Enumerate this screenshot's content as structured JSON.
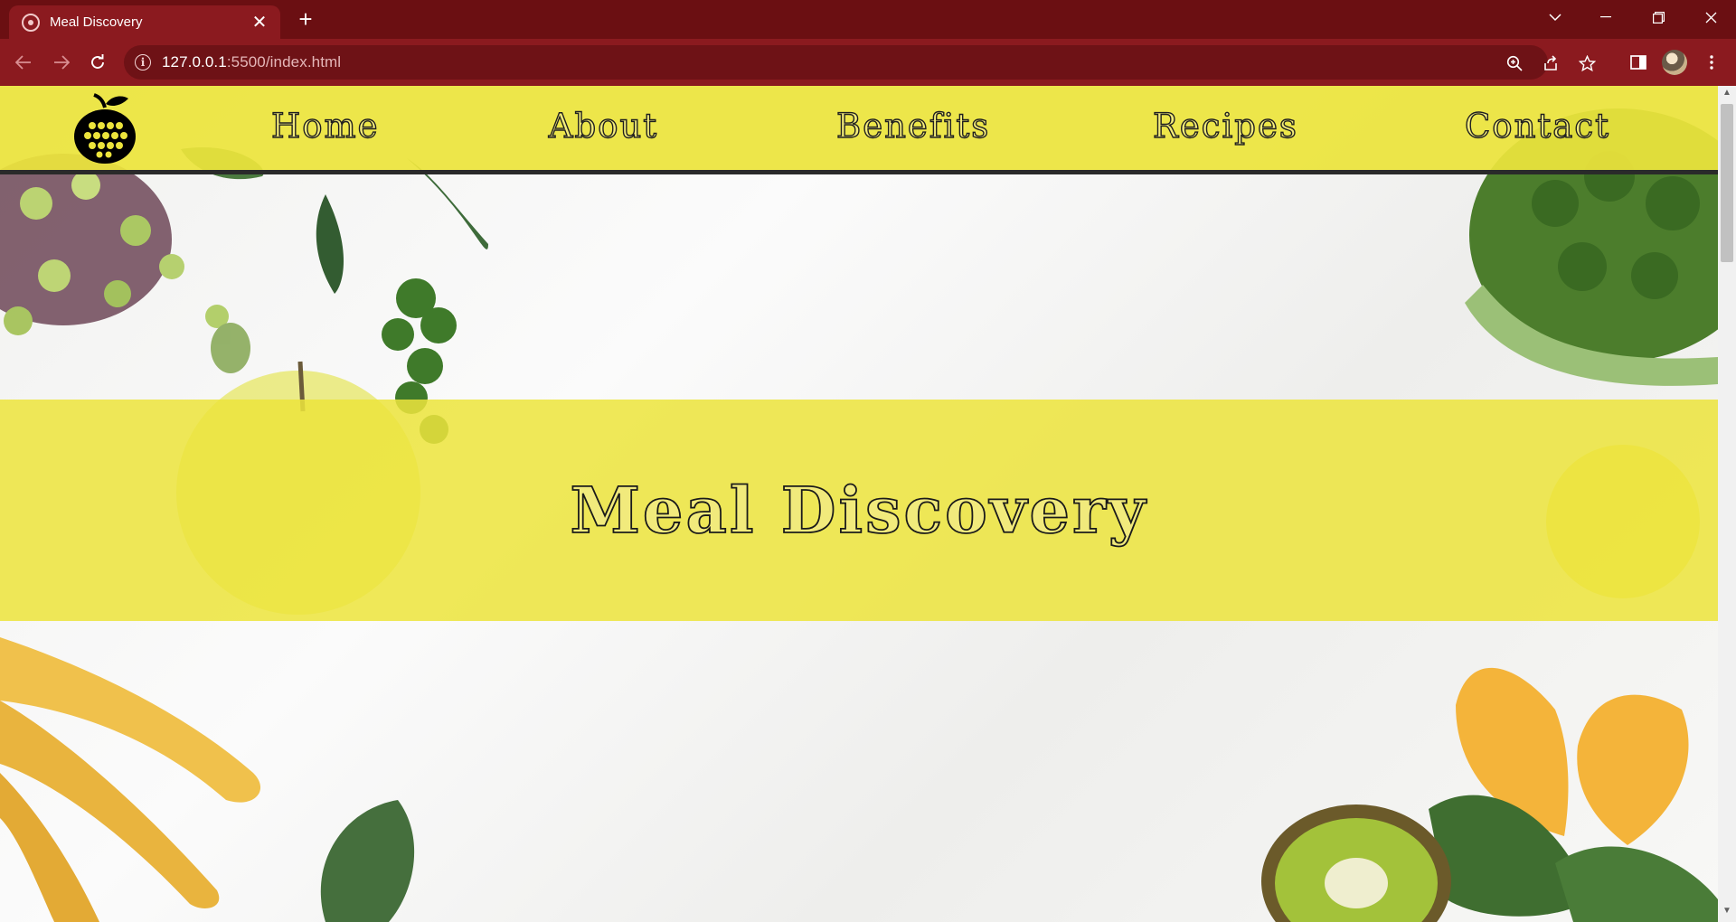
{
  "browser": {
    "tab_title": "Meal Discovery",
    "tab_close": "✕",
    "new_tab": "+",
    "url_host": "127.0.0.1",
    "url_rest": ":5500/index.html"
  },
  "site": {
    "nav": {
      "home": "Home",
      "about": "About",
      "benefits": "Benefits",
      "recipes": "Recipes",
      "contact": "Contact"
    },
    "hero_title": "Meal Discovery"
  },
  "colors": {
    "browser_frame": "#6b0f12",
    "browser_toolbar": "#8b1a1f",
    "nav_yellow": "#ece43c",
    "nav_border": "#2a2a2a"
  }
}
